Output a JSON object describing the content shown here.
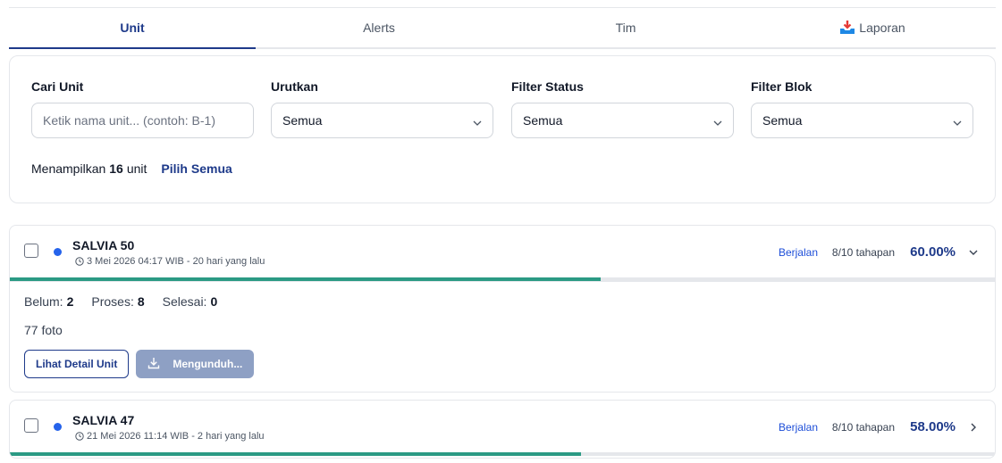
{
  "tabs": [
    {
      "label": "Unit",
      "active": true
    },
    {
      "label": "Alerts",
      "active": false
    },
    {
      "label": "Tim",
      "active": false
    },
    {
      "label": "Laporan",
      "active": false,
      "icon": "inbox-tray-icon"
    }
  ],
  "filters": {
    "search": {
      "label": "Cari Unit",
      "placeholder": "Ketik nama unit... (contoh: B-1)",
      "value": ""
    },
    "sort": {
      "label": "Urutkan",
      "value": "Semua"
    },
    "status": {
      "label": "Filter Status",
      "value": "Semua"
    },
    "block": {
      "label": "Filter Blok",
      "value": "Semua"
    }
  },
  "summary": {
    "prefix": "Menampilkan",
    "count": "16",
    "suffix": "unit",
    "select_all": "Pilih Semua"
  },
  "units": [
    {
      "name": "SALVIA 50",
      "date": "3 Mei 2026 04:17 WIB - 20 hari yang lalu",
      "status": "Berjalan",
      "steps": "8/10 tahapan",
      "percent": "60.00%",
      "progress": 0.6,
      "expanded": true,
      "counts": {
        "belum_label": "Belum:",
        "belum": "2",
        "proses_label": "Proses:",
        "proses": "8",
        "selesai_label": "Selesai:",
        "selesai": "0"
      },
      "photos": "77 foto",
      "detail_button": "Lihat Detail Unit",
      "download_button": "Mengunduh..."
    },
    {
      "name": "SALVIA 47",
      "date": "21 Mei 2026 11:14 WIB - 2 hari yang lalu",
      "status": "Berjalan",
      "steps": "8/10 tahapan",
      "percent": "58.00%",
      "progress": 0.58,
      "expanded": false
    }
  ],
  "colors": {
    "accent": "#1e3a8a",
    "status_blue": "#1d4ed8",
    "progress_green": "#2b9a84",
    "dot_blue": "#2563eb",
    "disabled_button": "#8ea0c4"
  }
}
